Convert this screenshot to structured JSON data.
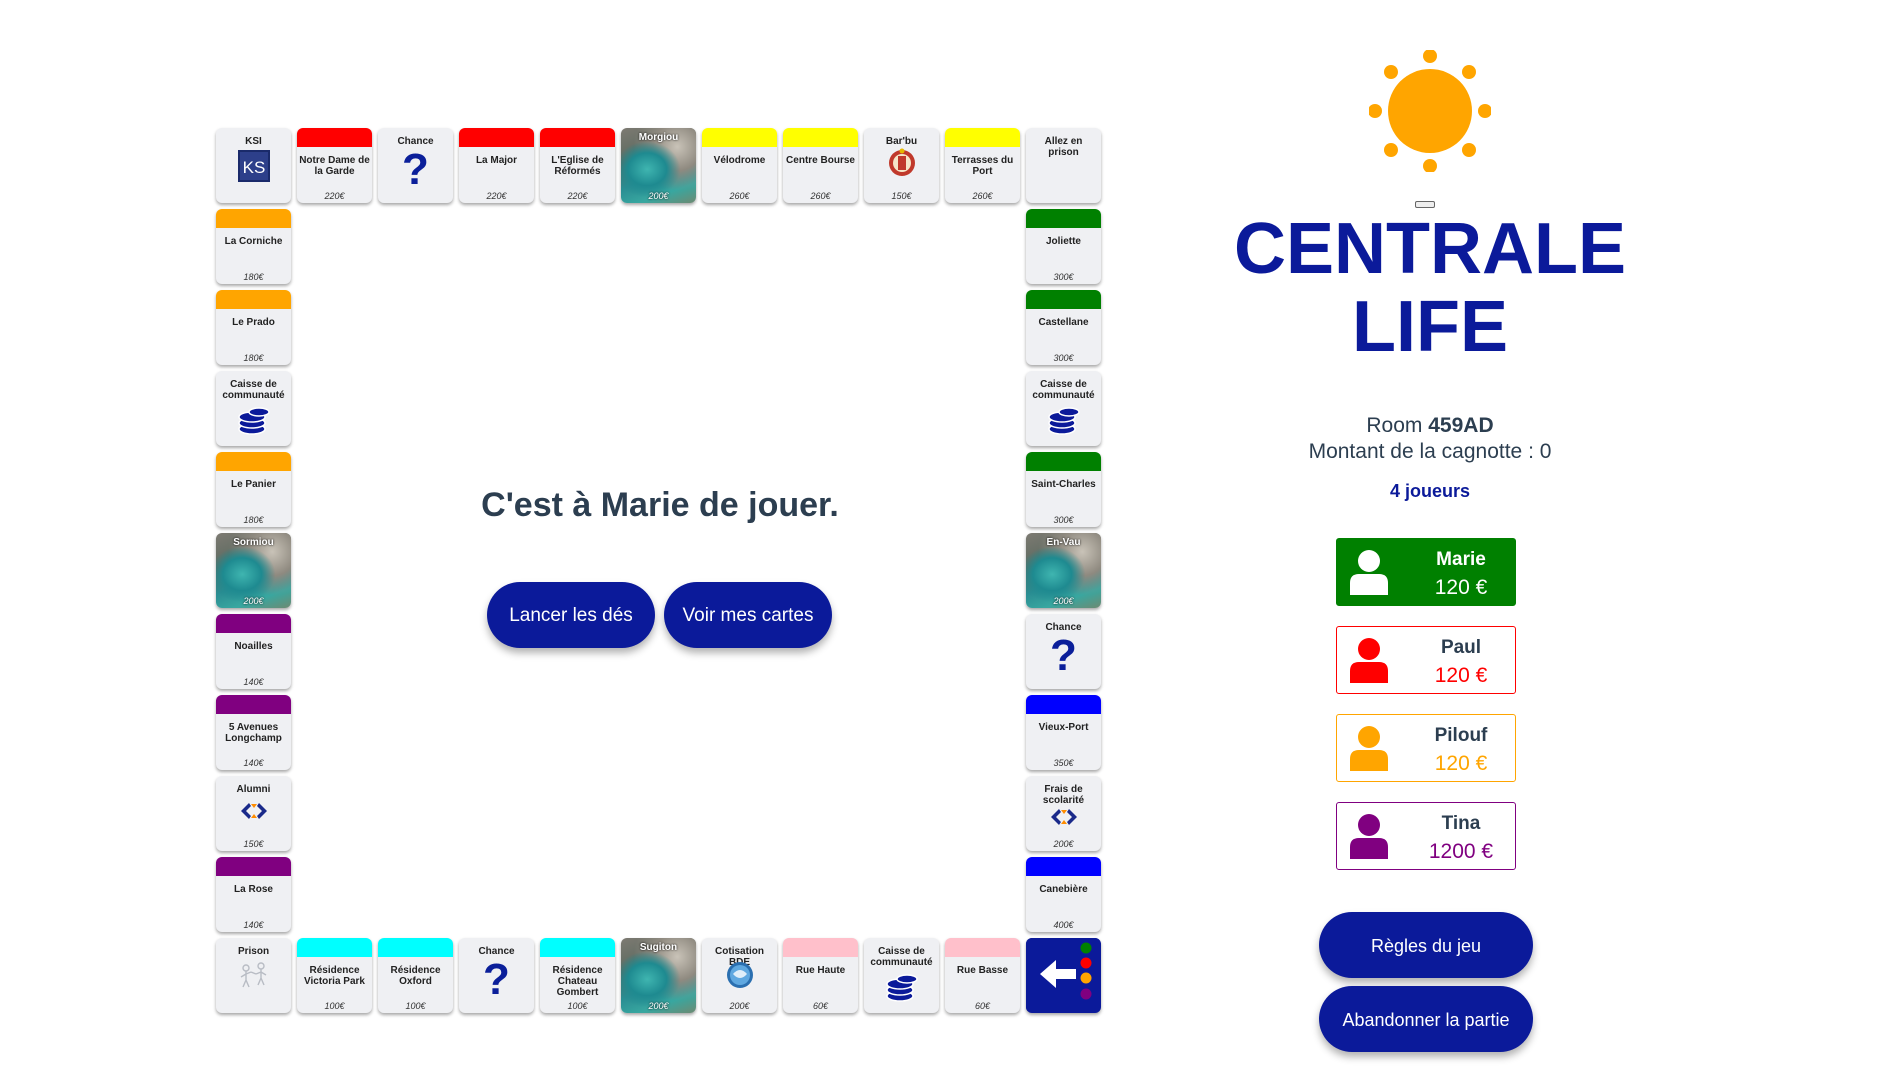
{
  "board": {
    "top": [
      {
        "kind": "corner-ksi",
        "name": "KSI",
        "icon": "ksi-logo-icon"
      },
      {
        "kind": "property",
        "name": "Notre Dame de la Garde",
        "price": "220€",
        "color": "#ff0000"
      },
      {
        "kind": "chance",
        "name": "Chance",
        "icon": "question-mark-icon"
      },
      {
        "kind": "property",
        "name": "La Major",
        "price": "220€",
        "color": "#ff0000"
      },
      {
        "kind": "property",
        "name": "L'Eglise de Réformés",
        "price": "220€",
        "color": "#ff0000"
      },
      {
        "kind": "photo",
        "name": "Morgiou",
        "price": "200€"
      },
      {
        "kind": "property",
        "name": "Vélodrome",
        "price": "260€",
        "color": "#ffff00"
      },
      {
        "kind": "property",
        "name": "Centre Bourse",
        "price": "260€",
        "color": "#ffff00"
      },
      {
        "kind": "special",
        "name": "Bar'bu",
        "price": "150€",
        "icon": "barbu-logo-icon"
      },
      {
        "kind": "property",
        "name": "Terrasses du Port",
        "price": "260€",
        "color": "#ffff00"
      },
      {
        "kind": "corner",
        "name": "Allez en prison"
      }
    ],
    "left": [
      {
        "kind": "property",
        "name": "La Corniche",
        "price": "180€",
        "color": "#ffa500"
      },
      {
        "kind": "property",
        "name": "Le Prado",
        "price": "180€",
        "color": "#ffa500"
      },
      {
        "kind": "community",
        "name": "Caisse de communauté",
        "icon": "coins-icon"
      },
      {
        "kind": "property",
        "name": "Le Panier",
        "price": "180€",
        "color": "#ffa500"
      },
      {
        "kind": "photo",
        "name": "Sormiou",
        "price": "200€"
      },
      {
        "kind": "property",
        "name": "Noailles",
        "price": "140€",
        "color": "#800080"
      },
      {
        "kind": "property",
        "name": "5 Avenues Longchamp",
        "price": "140€",
        "color": "#800080"
      },
      {
        "kind": "special",
        "name": "Alumni",
        "price": "150€",
        "icon": "alumni-logo-icon"
      },
      {
        "kind": "property",
        "name": "La Rose",
        "price": "140€",
        "color": "#800080"
      }
    ],
    "right": [
      {
        "kind": "property",
        "name": "Joliette",
        "price": "300€",
        "color": "#008000"
      },
      {
        "kind": "property",
        "name": "Castellane",
        "price": "300€",
        "color": "#008000"
      },
      {
        "kind": "community",
        "name": "Caisse de communauté",
        "icon": "coins-icon"
      },
      {
        "kind": "property",
        "name": "Saint-Charles",
        "price": "300€",
        "color": "#008000"
      },
      {
        "kind": "photo",
        "name": "En-Vau",
        "price": "200€"
      },
      {
        "kind": "chance",
        "name": "Chance",
        "icon": "question-mark-icon"
      },
      {
        "kind": "property",
        "name": "Vieux-Port",
        "price": "350€",
        "color": "#0000ff"
      },
      {
        "kind": "special",
        "name": "Frais de scolarité",
        "price": "200€",
        "icon": "centrale-logo-icon"
      },
      {
        "kind": "property",
        "name": "Canebière",
        "price": "400€",
        "color": "#0000ff"
      }
    ],
    "bottom": [
      {
        "kind": "corner-prison",
        "name": "Prison",
        "icon": "prison-icon"
      },
      {
        "kind": "property",
        "name": "Résidence Victoria Park",
        "price": "100€",
        "color": "#00ffff"
      },
      {
        "kind": "property",
        "name": "Résidence Oxford",
        "price": "100€",
        "color": "#00ffff"
      },
      {
        "kind": "chance",
        "name": "Chance",
        "icon": "question-mark-icon"
      },
      {
        "kind": "property",
        "name": "Résidence Chateau Gombert",
        "price": "100€",
        "color": "#00ffff"
      },
      {
        "kind": "photo",
        "name": "Sugiton",
        "price": "200€"
      },
      {
        "kind": "special",
        "name": "Cotisation BDE",
        "price": "200€",
        "icon": "bde-logo-icon"
      },
      {
        "kind": "property",
        "name": "Rue Haute",
        "price": "60€",
        "color": "#ffc0cb"
      },
      {
        "kind": "community",
        "name": "Caisse de communauté",
        "icon": "coins-icon"
      },
      {
        "kind": "property",
        "name": "Rue Basse",
        "price": "60€",
        "color": "#ffc0cb"
      },
      {
        "kind": "corner-start",
        "name": "",
        "icon": "start-arrow-icon"
      }
    ]
  },
  "center": {
    "turn_text": "C'est à Marie de jouer.",
    "roll_label": "Lancer les dés",
    "cards_label": "Voir mes cartes"
  },
  "sidebar": {
    "logo_icon": "sun-icon",
    "title_line1": "CENTRALE",
    "title_line2": "LIFE",
    "room_label": "Room",
    "room_code": "459AD",
    "pot_text": "Montant de la cagnotte : 0",
    "players_count": "4 joueurs",
    "players": [
      {
        "name": "Marie",
        "money": "120 €",
        "color": "#008000",
        "active": true
      },
      {
        "name": "Paul",
        "money": "120 €",
        "color": "#ff0000",
        "active": false
      },
      {
        "name": "Pilouf",
        "money": "120 €",
        "color": "#ffa500",
        "active": false
      },
      {
        "name": "Tina",
        "money": "1200 €",
        "color": "#800080",
        "active": false
      }
    ],
    "rules_label": "Règles du jeu",
    "quit_label": "Abandonner la partie"
  },
  "colors": {
    "accent": "#0b1a9a",
    "sun": "#ffa500"
  }
}
